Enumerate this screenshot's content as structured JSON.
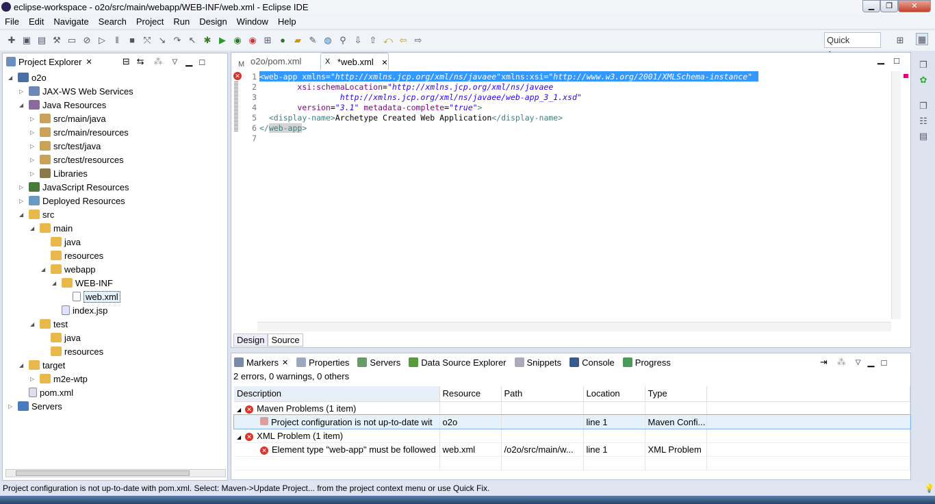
{
  "window": {
    "title": "eclipse-workspace - o2o/src/main/webapp/WEB-INF/web.xml - Eclipse IDE"
  },
  "menu": [
    "File",
    "Edit",
    "Navigate",
    "Search",
    "Project",
    "Run",
    "Design",
    "Window",
    "Help"
  ],
  "toolbar": {
    "quick_access": "Quick Access"
  },
  "explorer": {
    "title": "Project Explorer",
    "items": [
      {
        "label": "o2o",
        "depth": 0,
        "open": true,
        "icon": "project"
      },
      {
        "label": "JAX-WS Web Services",
        "depth": 1,
        "open": false,
        "icon": "ws"
      },
      {
        "label": "Java Resources",
        "depth": 1,
        "open": true,
        "icon": "java-res"
      },
      {
        "label": "src/main/java",
        "depth": 2,
        "open": false,
        "icon": "package-folder"
      },
      {
        "label": "src/main/resources",
        "depth": 2,
        "open": false,
        "icon": "package-folder"
      },
      {
        "label": "src/test/java",
        "depth": 2,
        "open": false,
        "icon": "package-folder"
      },
      {
        "label": "src/test/resources",
        "depth": 2,
        "open": false,
        "icon": "package-folder"
      },
      {
        "label": "Libraries",
        "depth": 2,
        "open": false,
        "icon": "library"
      },
      {
        "label": "JavaScript Resources",
        "depth": 1,
        "open": false,
        "icon": "js"
      },
      {
        "label": "Deployed Resources",
        "depth": 1,
        "open": false,
        "icon": "deployed"
      },
      {
        "label": "src",
        "depth": 1,
        "open": true,
        "icon": "folder"
      },
      {
        "label": "main",
        "depth": 2,
        "open": true,
        "icon": "folder"
      },
      {
        "label": "java",
        "depth": 3,
        "leaf": true,
        "icon": "folder"
      },
      {
        "label": "resources",
        "depth": 3,
        "leaf": true,
        "icon": "folder"
      },
      {
        "label": "webapp",
        "depth": 3,
        "open": true,
        "icon": "folder"
      },
      {
        "label": "WEB-INF",
        "depth": 4,
        "open": true,
        "icon": "folder"
      },
      {
        "label": "web.xml",
        "depth": 5,
        "leaf": true,
        "icon": "xml",
        "selected": true
      },
      {
        "label": "index.jsp",
        "depth": 4,
        "leaf": true,
        "icon": "jsp"
      },
      {
        "label": "test",
        "depth": 2,
        "open": true,
        "icon": "folder"
      },
      {
        "label": "java",
        "depth": 3,
        "leaf": true,
        "icon": "folder"
      },
      {
        "label": "resources",
        "depth": 3,
        "leaf": true,
        "icon": "folder"
      },
      {
        "label": "target",
        "depth": 1,
        "open": true,
        "icon": "folder"
      },
      {
        "label": "m2e-wtp",
        "depth": 2,
        "open": false,
        "icon": "folder"
      },
      {
        "label": "pom.xml",
        "depth": 1,
        "leaf": true,
        "icon": "maven"
      },
      {
        "label": "Servers",
        "depth": 0,
        "open": false,
        "icon": "folder-blue"
      }
    ]
  },
  "editor": {
    "tabs": [
      {
        "label": "o2o/pom.xml",
        "active": false
      },
      {
        "label": "*web.xml",
        "active": true
      }
    ],
    "bottom_tabs": [
      "Design",
      "Source"
    ],
    "active_bottom_tab": "Source",
    "lines": [
      "1",
      "2",
      "3",
      "4",
      "5",
      "6",
      "7"
    ]
  },
  "markers": {
    "tabs": [
      "Markers",
      "Properties",
      "Servers",
      "Data Source Explorer",
      "Snippets",
      "Console",
      "Progress"
    ],
    "summary": "2 errors, 0 warnings, 0 others",
    "columns": [
      "Description",
      "Resource",
      "Path",
      "Location",
      "Type"
    ],
    "rows": [
      {
        "group": true,
        "description": "Maven Problems (1 item)"
      },
      {
        "description": "Project configuration is not up-to-date wit",
        "resource": "o2o",
        "path": "",
        "location": "line 1",
        "type": "Maven Confi...",
        "selected": true
      },
      {
        "group": true,
        "description": "XML Problem (1 item)"
      },
      {
        "description": "Element type \"web-app\" must be followed",
        "resource": "web.xml",
        "path": "/o2o/src/main/w...",
        "location": "line 1",
        "type": "XML Problem"
      }
    ]
  },
  "status": "Project configuration is not up-to-date with pom.xml. Select: Maven->Update Project... from the project context menu or use Quick Fix."
}
